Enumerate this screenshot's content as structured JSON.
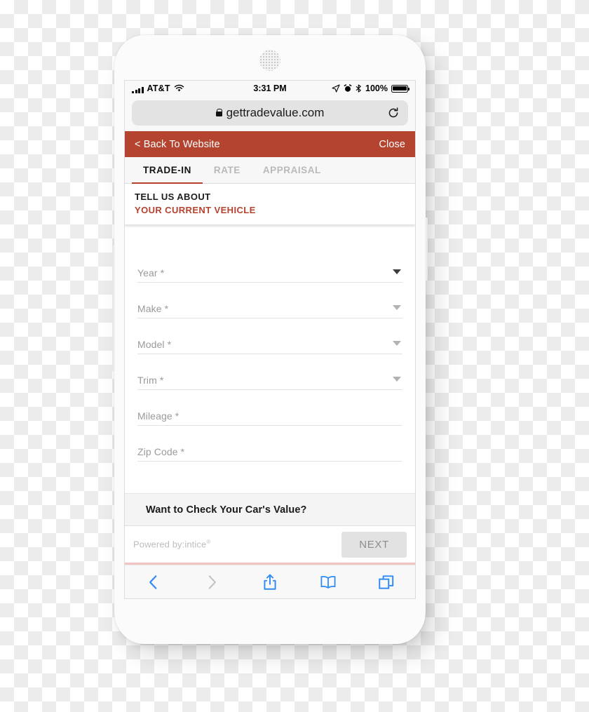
{
  "status_bar": {
    "carrier": "AT&T",
    "time": "3:31 PM",
    "battery_pct": "100%",
    "icons": [
      "signal-bars-icon",
      "wifi-icon",
      "location-arrow-icon",
      "alarm-clock-icon",
      "bluetooth-icon",
      "battery-icon"
    ]
  },
  "browser": {
    "url": "gettradevalue.com",
    "lock_icon": "lock-icon",
    "reload_icon": "reload-icon",
    "toolbar": {
      "back": "back-chevron-icon",
      "forward": "forward-chevron-icon",
      "share": "share-icon",
      "bookmarks": "book-icon",
      "tabs": "tabs-icon"
    }
  },
  "app_header": {
    "back_label": "< Back To Website",
    "close_label": "Close",
    "bar_color": "#b4432f"
  },
  "tabs": [
    {
      "label": "TRADE-IN",
      "active": true
    },
    {
      "label": "RATE",
      "active": false
    },
    {
      "label": "APPRAISAL",
      "active": false
    }
  ],
  "section": {
    "line1": "TELL US ABOUT",
    "line2": "YOUR CURRENT VEHICLE",
    "accent_color": "#b4432f"
  },
  "form": {
    "fields": [
      {
        "label": "Year *",
        "type": "select",
        "value": ""
      },
      {
        "label": "Make *",
        "type": "select",
        "value": ""
      },
      {
        "label": "Model *",
        "type": "select",
        "value": ""
      },
      {
        "label": "Trim *",
        "type": "select",
        "value": ""
      },
      {
        "label": "Mileage *",
        "type": "text",
        "value": ""
      },
      {
        "label": "Zip Code *",
        "type": "text",
        "value": ""
      }
    ]
  },
  "cta": {
    "text": "Want to Check Your Car's Value?"
  },
  "footer": {
    "powered_by": "Powered by:intice",
    "powered_by_mark": "®",
    "next_label": "NEXT"
  }
}
